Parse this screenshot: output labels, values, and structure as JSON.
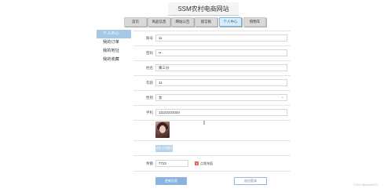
{
  "site": {
    "title": "SSM农村电商网站"
  },
  "nav": {
    "items": [
      {
        "label": "首页"
      },
      {
        "label": "商品信息"
      },
      {
        "label": "网站公告"
      },
      {
        "label": "留言板"
      },
      {
        "label": "个人中心",
        "active": true
      },
      {
        "label": "购物车"
      }
    ]
  },
  "sidebar": {
    "items": [
      {
        "label": "个人中心",
        "active": true
      },
      {
        "label": "我的订单"
      },
      {
        "label": "我的地址"
      },
      {
        "label": "我的收藏"
      }
    ]
  },
  "form": {
    "account": {
      "label": "账号",
      "value": "11"
    },
    "password": {
      "label": "密码",
      "value": "••"
    },
    "name": {
      "label": "姓名",
      "value": "黄三分"
    },
    "age": {
      "label": "年龄",
      "value": "11"
    },
    "gender": {
      "label": "性别",
      "value": "女"
    },
    "phone": {
      "label": "手机",
      "value": "11122223334"
    },
    "upload_label": "点击上传图片",
    "balance": {
      "label": "余额",
      "value": "7722"
    },
    "recharge_label": "点我充值",
    "update_label": "更新信息",
    "logout_label": "退出登录"
  },
  "watermark": "CSDN @ebuckt123"
}
